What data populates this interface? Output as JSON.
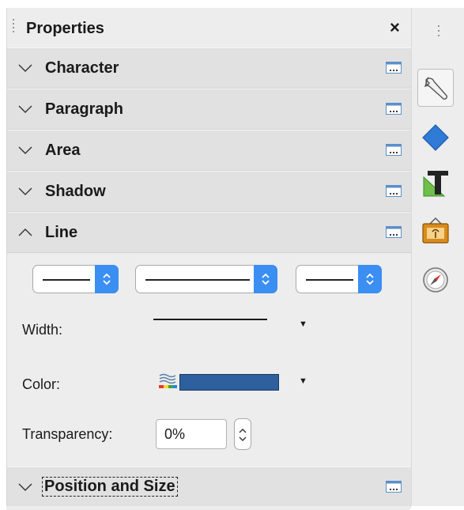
{
  "panel": {
    "title": "Properties",
    "close_symbol": "×"
  },
  "sections": [
    {
      "label": "Character",
      "expanded": false
    },
    {
      "label": "Paragraph",
      "expanded": false
    },
    {
      "label": "Area",
      "expanded": false
    },
    {
      "label": "Shadow",
      "expanded": false
    },
    {
      "label": "Line",
      "expanded": true
    },
    {
      "label": "Position and Size",
      "expanded": false
    }
  ],
  "line": {
    "width_label": "Width:",
    "color_label": "Color:",
    "transparency_label": "Transparency:",
    "transparency_value": "0%",
    "color_value": "#2e5f9e"
  },
  "tabs": [
    {
      "icon": "wrench-icon",
      "active": true
    },
    {
      "icon": "diamond-shape-icon",
      "active": false
    },
    {
      "icon": "text-styles-icon",
      "active": false
    },
    {
      "icon": "gallery-picture-icon",
      "active": false
    },
    {
      "icon": "navigator-compass-icon",
      "active": false
    }
  ],
  "colors": {
    "accent": "#3b8ef2",
    "panel_bg": "#ededed",
    "section_bg": "#e1e1e1"
  }
}
